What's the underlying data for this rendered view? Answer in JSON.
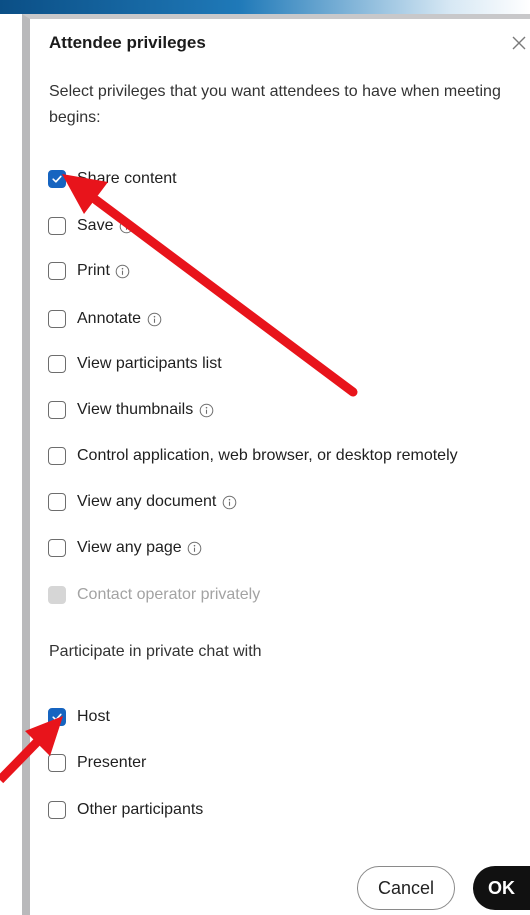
{
  "dialog": {
    "title": "Attendee privileges",
    "description": "Select privileges that you want attendees to have when meeting begins:"
  },
  "privileges": [
    {
      "label": "Share content",
      "checked": true,
      "info": false,
      "disabled": false
    },
    {
      "label": "Save",
      "checked": false,
      "info": true,
      "disabled": false
    },
    {
      "label": "Print",
      "checked": false,
      "info": true,
      "disabled": false
    },
    {
      "label": "Annotate",
      "checked": false,
      "info": true,
      "disabled": false
    },
    {
      "label": "View participants list",
      "checked": false,
      "info": false,
      "disabled": false
    },
    {
      "label": "View thumbnails",
      "checked": false,
      "info": true,
      "disabled": false
    },
    {
      "label": "Control application, web browser, or desktop remotely",
      "checked": false,
      "info": false,
      "disabled": false
    },
    {
      "label": "View any document",
      "checked": false,
      "info": true,
      "disabled": false
    },
    {
      "label": "View any page",
      "checked": false,
      "info": true,
      "disabled": false
    },
    {
      "label": "Contact operator privately",
      "checked": false,
      "info": false,
      "disabled": true
    }
  ],
  "chat": {
    "heading": "Participate in private chat with",
    "options": [
      {
        "label": "Host",
        "checked": true
      },
      {
        "label": "Presenter",
        "checked": false
      },
      {
        "label": "Other participants",
        "checked": false
      }
    ]
  },
  "buttons": {
    "cancel": "Cancel",
    "ok": "OK"
  },
  "colors": {
    "accent": "#1664c0",
    "annotation_arrow": "#e8141b"
  }
}
